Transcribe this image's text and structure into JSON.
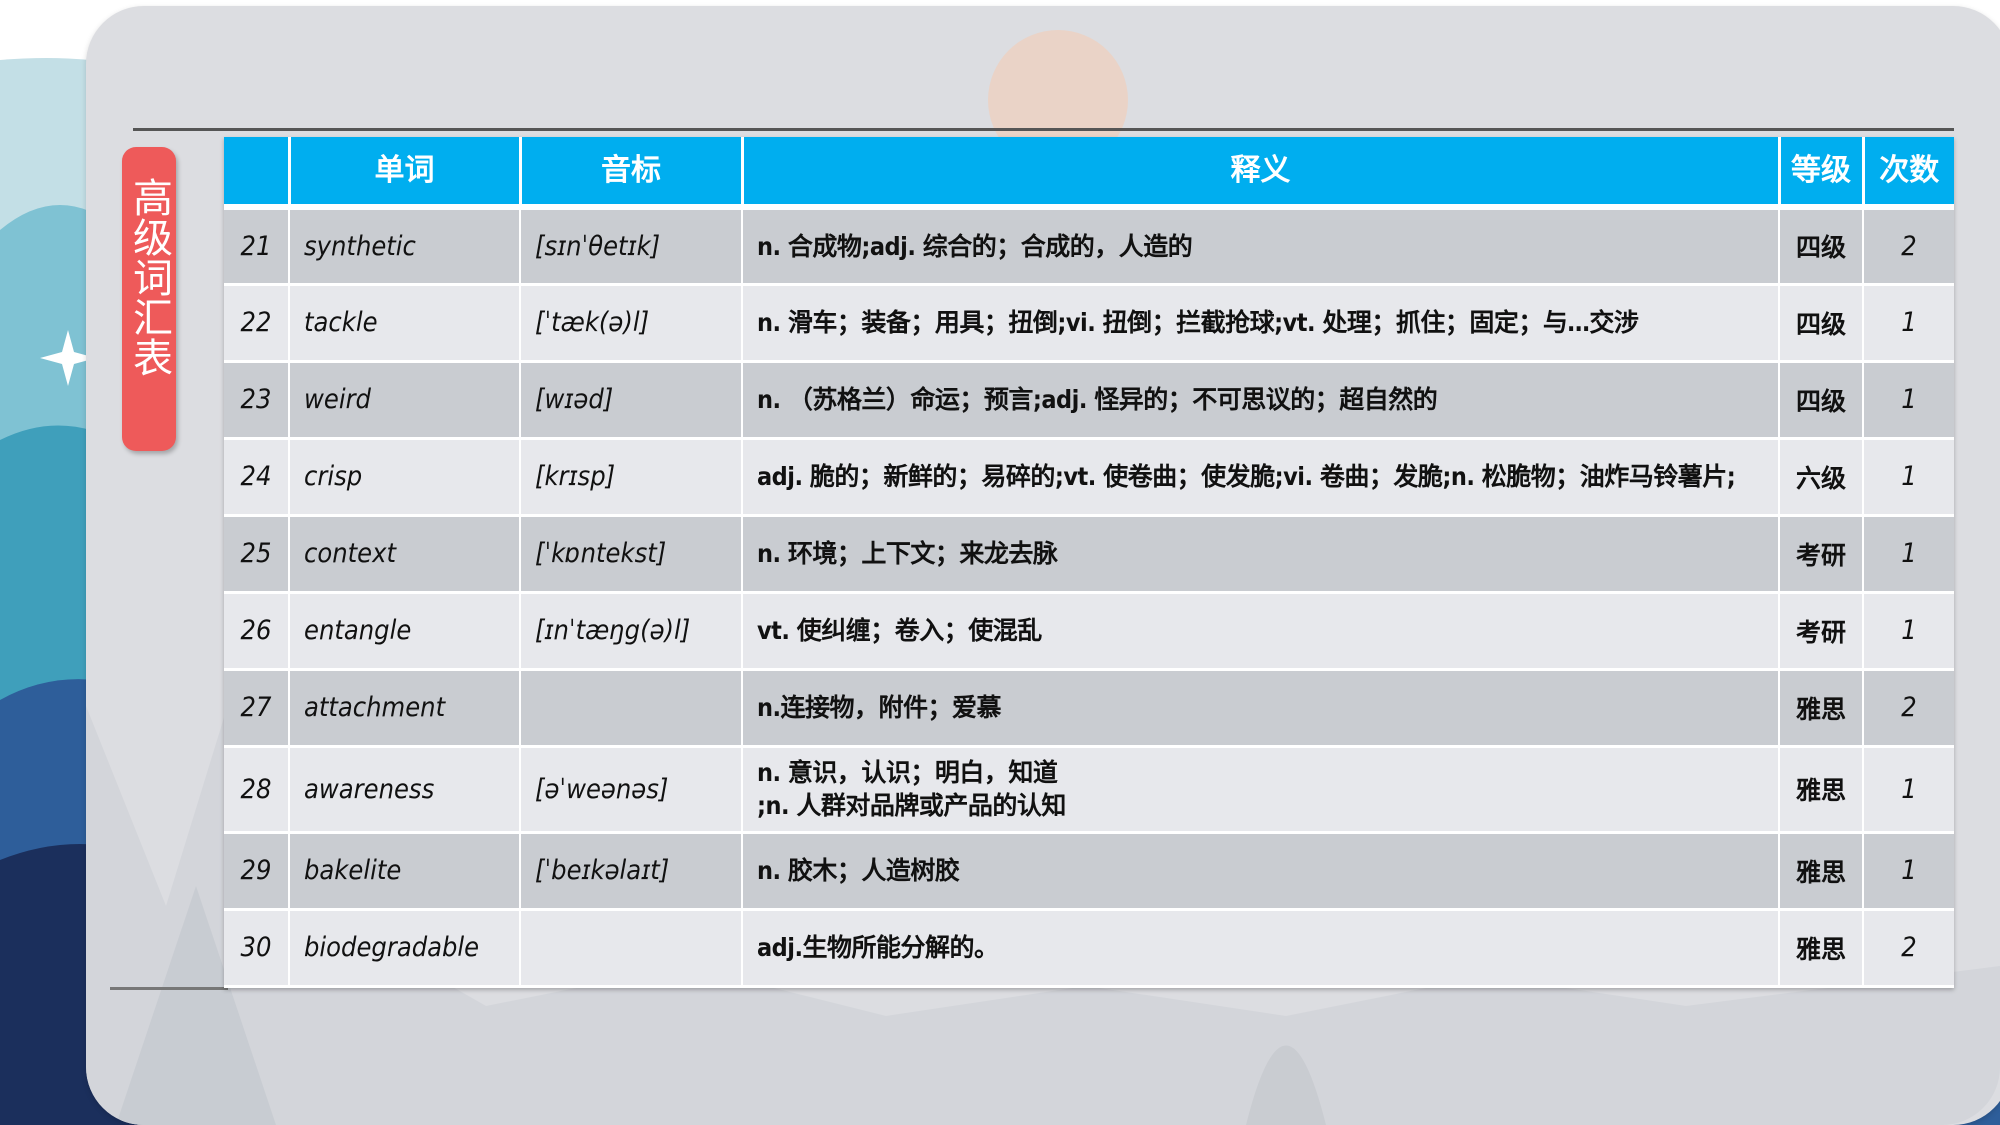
{
  "side_tab": {
    "title": "高级词汇表"
  },
  "table": {
    "headers": [
      "",
      "单词",
      "音标",
      "释义",
      "等级",
      "次数"
    ],
    "rows": [
      {
        "num": "21",
        "word": "synthetic",
        "phonetic": "[sɪnˈθetɪk]",
        "definition": "n. 合成物;adj. 综合的；合成的，人造的",
        "level": "四级",
        "count": "2"
      },
      {
        "num": "22",
        "word": "tackle",
        "phonetic": "[ˈtæk(ə)l]",
        "definition": "n. 滑车；装备；用具；扭倒;vi. 扭倒；拦截抢球;vt. 处理；抓住；固定；与…交涉",
        "level": "四级",
        "count": "1"
      },
      {
        "num": "23",
        "word": "weird",
        "phonetic": "[wɪəd]",
        "definition": "n. （苏格兰）命运；预言;adj. 怪异的；不可思议的；超自然的",
        "level": "四级",
        "count": "1"
      },
      {
        "num": "24",
        "word": "crisp",
        "phonetic": "[krɪsp]",
        "definition": "adj. 脆的；新鲜的；易碎的;vt. 使卷曲；使发脆;vi. 卷曲；发脆;n. 松脆物；油炸马铃薯片;",
        "level": "六级",
        "count": "1"
      },
      {
        "num": "25",
        "word": "context",
        "phonetic": "[ˈkɒntekst]",
        "definition": "n. 环境；上下文；来龙去脉",
        "level": "考研",
        "count": "1"
      },
      {
        "num": "26",
        "word": "entangle",
        "phonetic": "[ɪnˈtæŋg(ə)l]",
        "definition": "vt. 使纠缠；卷入；使混乱",
        "level": "考研",
        "count": "1"
      },
      {
        "num": "27",
        "word": "attachment",
        "phonetic": "",
        "definition": "n.连接物，附件；爱慕",
        "level": "雅思",
        "count": "2"
      },
      {
        "num": "28",
        "word": "awareness",
        "phonetic": "[əˈweənəs]",
        "definition": "n. 意识，认识；明白，知道",
        "definition2": ";n. 人群对品牌或产品的认知",
        "level": "雅思",
        "count": "1"
      },
      {
        "num": "29",
        "word": "bakelite",
        "phonetic": "[ˈbeɪkəlaɪt]",
        "definition": "n. 胶木；人造树胶",
        "level": "雅思",
        "count": "1"
      },
      {
        "num": "30",
        "word": "biodegradable",
        "phonetic": "",
        "definition": "adj.生物所能分解的。",
        "level": "雅思",
        "count": "2"
      }
    ]
  },
  "colors": {
    "header_bg": "#00aeef",
    "side_tab_bg": "#ee5a5a",
    "row_dark": "#c9ccd1",
    "row_light": "#e7e8ec"
  }
}
